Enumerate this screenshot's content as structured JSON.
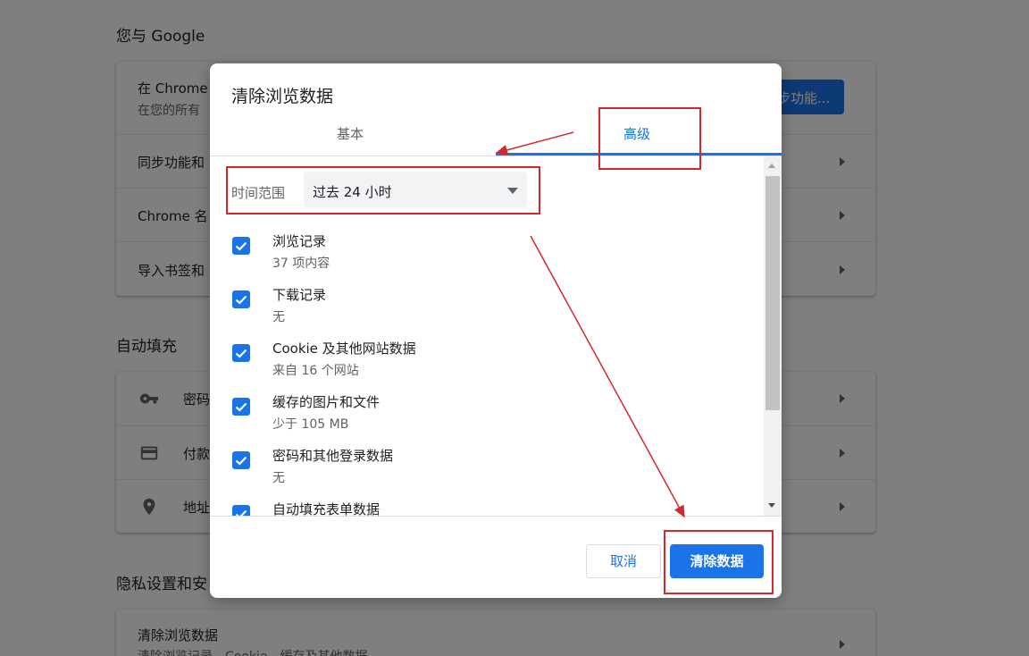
{
  "background": {
    "section_you_google": "您与 Google",
    "sync_row_title": "在 Chrome",
    "sync_row_sub": "在您的所有",
    "sync_button": "步功能...",
    "row_sync_services": "同步功能和",
    "row_chrome_name": "Chrome 名",
    "row_import": "导入书签和",
    "section_autofill": "自动填充",
    "row_passwords": "密码",
    "row_payments": "付款",
    "row_addresses": "地址",
    "section_privacy": "隐私设置和安",
    "row_clear_data": "清除浏览数据",
    "row_clear_data_sub": "清除浏览记录、Cookie、缓存及其他数据"
  },
  "dialog": {
    "title": "清除浏览数据",
    "tabs": [
      {
        "label": "基本"
      },
      {
        "label": "高级"
      }
    ],
    "active_tab": "高级",
    "time_range_label": "时间范围",
    "time_range_value": "过去 24 小时",
    "items": [
      {
        "label": "浏览记录",
        "sub": "37 项内容",
        "checked": true
      },
      {
        "label": "下载记录",
        "sub": "无",
        "checked": true
      },
      {
        "label": "Cookie 及其他网站数据",
        "sub": "来自 16 个网站",
        "checked": true
      },
      {
        "label": "缓存的图片和文件",
        "sub": "少于 105 MB",
        "checked": true
      },
      {
        "label": "密码和其他登录数据",
        "sub": "无",
        "checked": true
      },
      {
        "label": "自动填充表单数据",
        "sub": "",
        "checked": true
      }
    ],
    "cancel_label": "取消",
    "clear_label": "清除数据"
  },
  "colors": {
    "accent": "#1a73e8",
    "annotation": "#d9262c"
  }
}
